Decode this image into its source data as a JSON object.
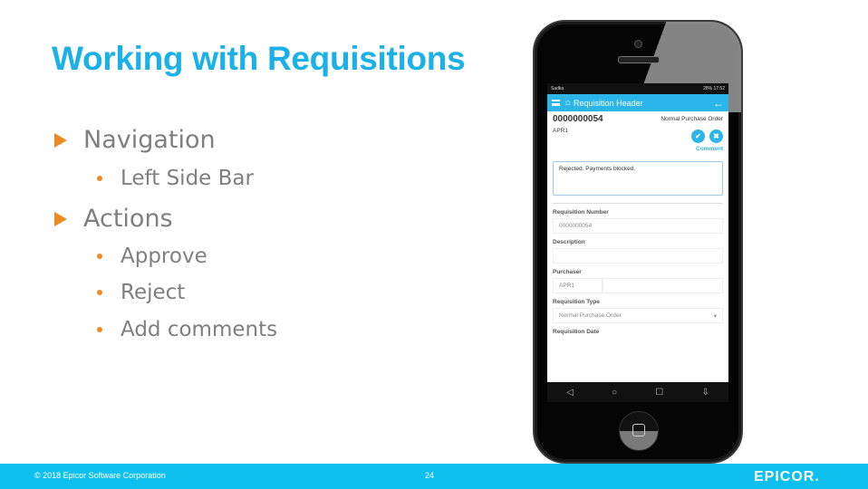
{
  "slide": {
    "title": "Working with Requisitions",
    "bullets": [
      {
        "label": "Navigation",
        "children": [
          "Left Side Bar"
        ]
      },
      {
        "label": "Actions",
        "children": [
          "Approve",
          "Reject",
          "Add comments"
        ]
      }
    ]
  },
  "footer": {
    "copyright": "© 2018 Epicor Software Corporation",
    "page_number": "24",
    "logo": "EPICOR."
  },
  "colors": {
    "title": "#1ab1e8",
    "bullet_accent": "#ed8b23",
    "footer_bar": "#0fc0ee",
    "app_bar": "#2bb5e8"
  },
  "phone": {
    "status_bar": {
      "left": "Sadka",
      "right": "28% 17:52"
    },
    "app_bar": {
      "menu_icon": "hamburger-icon",
      "home_icon": "home-icon",
      "title": "Requisition Header",
      "back_icon": "arrow-left-icon"
    },
    "header": {
      "requisition_number": "0000000054",
      "requisition_type": "Normal Purchase Order",
      "user": "APR1",
      "approve_icon": "✔",
      "reject_icon": "✖",
      "comment_label": "Comment"
    },
    "comment_value": "Rejected. Payments blocked.",
    "fields": {
      "requisition_number_label": "Requisition Number",
      "requisition_number_value": "0000000054",
      "description_label": "Description",
      "description_value": "",
      "purchaser_label": "Purchaser",
      "purchaser_value": "APR1",
      "requisition_type_label": "Requisition Type",
      "requisition_type_value": "Normal Purchase Order",
      "requisition_date_label": "Requisition Date"
    },
    "nav": {
      "back": "◁",
      "home": "○",
      "recent": "☐",
      "extra": "⇩"
    }
  }
}
